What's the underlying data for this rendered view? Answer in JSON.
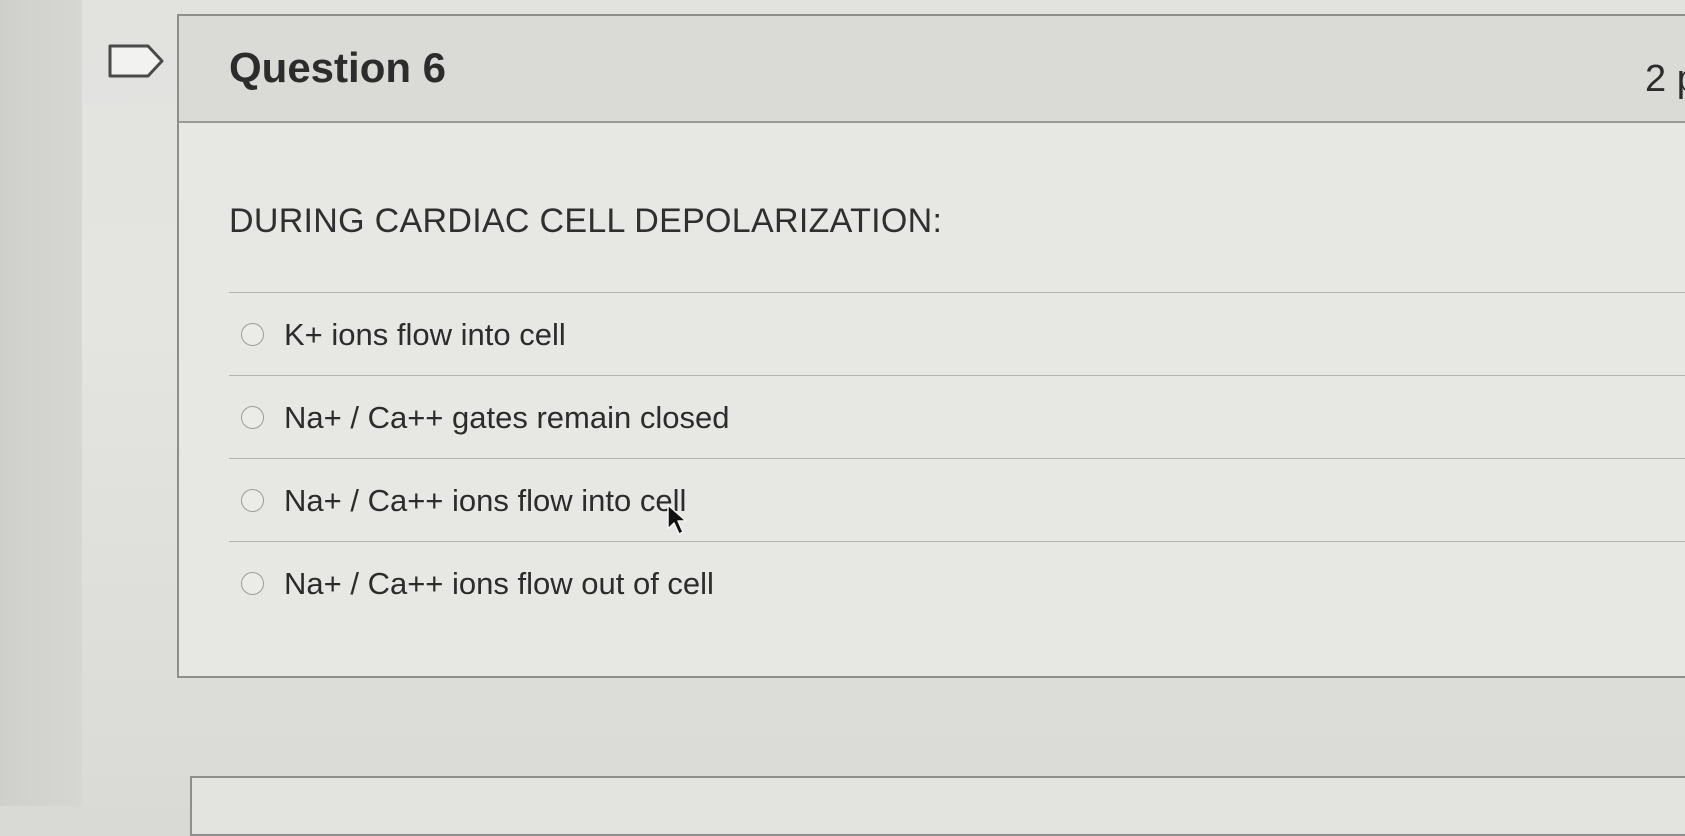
{
  "question": {
    "title": "Question 6",
    "points": "2 p",
    "prompt": "DURING CARDIAC CELL DEPOLARIZATION:",
    "answers": [
      {
        "label": "K+ ions flow into cell"
      },
      {
        "label": "Na+ / Ca++ gates remain closed"
      },
      {
        "label": "Na+ / Ca++ ions flow into cell"
      },
      {
        "label": "Na+ / Ca++ ions flow out of cell"
      }
    ]
  },
  "icons": {
    "flag": "flag-question-icon",
    "cursor": "mouse-pointer-icon"
  },
  "colors": {
    "background": "#e2e2df",
    "header": "#dadad7",
    "border": "#8e8e8c",
    "text": "#2c2c2c"
  }
}
